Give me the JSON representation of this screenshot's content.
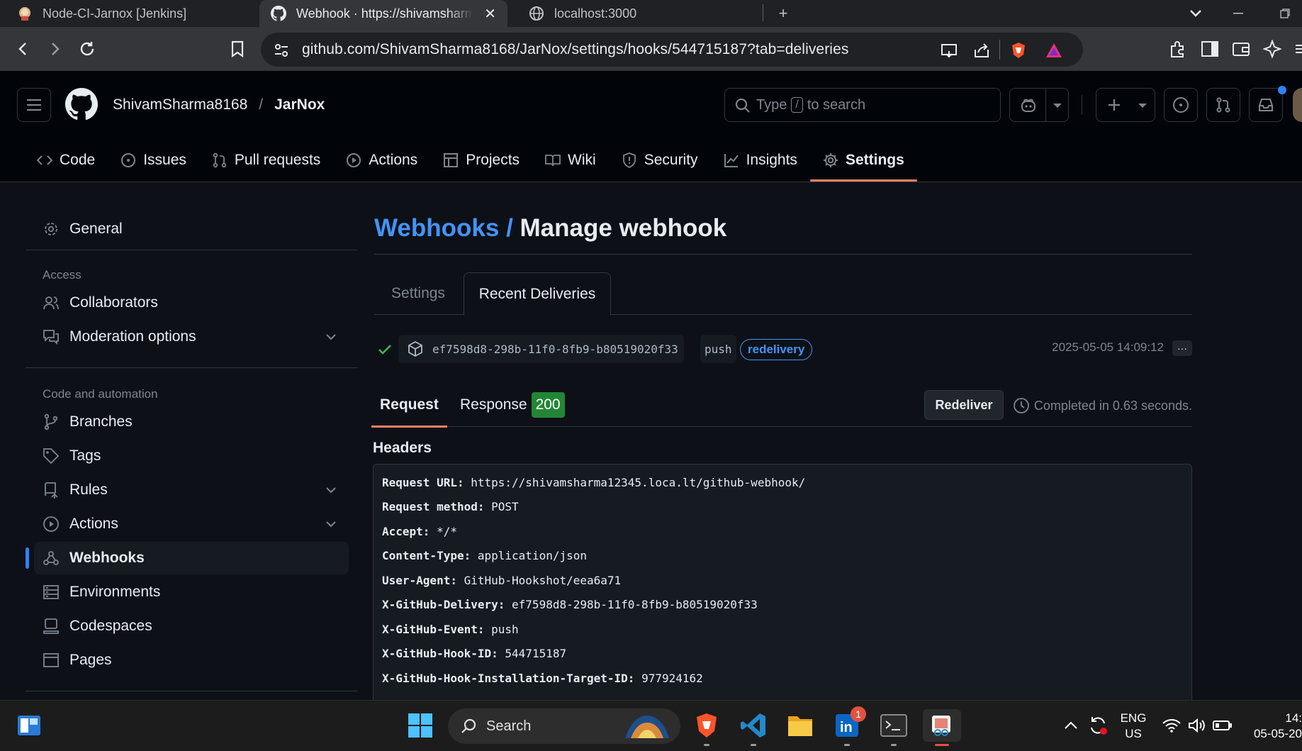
{
  "browser": {
    "tabs": [
      {
        "title": "Node-CI-Jarnox [Jenkins]"
      },
      {
        "title": "Webhook · https://shivamsharm",
        "active": true
      },
      {
        "title": "localhost:3000"
      }
    ],
    "url": "github.com/ShivamSharma8168/JarNox/settings/hooks/544715187?tab=deliveries"
  },
  "header": {
    "owner": "ShivamSharma8168",
    "separator": "/",
    "repo": "JarNox",
    "search_prefix": "Type",
    "search_key": "/",
    "search_suffix": "to search"
  },
  "repo_nav": [
    {
      "label": "Code",
      "icon": "code-icon"
    },
    {
      "label": "Issues",
      "icon": "issue-icon"
    },
    {
      "label": "Pull requests",
      "icon": "pull-request-icon"
    },
    {
      "label": "Actions",
      "icon": "play-icon"
    },
    {
      "label": "Projects",
      "icon": "table-icon"
    },
    {
      "label": "Wiki",
      "icon": "book-icon"
    },
    {
      "label": "Security",
      "icon": "shield-icon"
    },
    {
      "label": "Insights",
      "icon": "graph-icon"
    },
    {
      "label": "Settings",
      "icon": "gear-icon",
      "selected": true
    }
  ],
  "sidebar": {
    "general": "General",
    "access_heading": "Access",
    "access_items": [
      "Collaborators",
      "Moderation options"
    ],
    "code_heading": "Code and automation",
    "code_items": [
      "Branches",
      "Tags",
      "Rules",
      "Actions",
      "Webhooks",
      "Environments",
      "Codespaces",
      "Pages"
    ],
    "active": "Webhooks"
  },
  "main": {
    "breadcrumb": "Webhooks",
    "breadcrumb_sep": "/",
    "title": "Manage webhook",
    "tabs": [
      "Settings",
      "Recent Deliveries"
    ],
    "active_tab": "Recent Deliveries",
    "delivery": {
      "guid": "ef7598d8-298b-11f0-8fb9-b80519020f33",
      "event": "push",
      "badge": "redelivery",
      "timestamp": "2025-05-05 14:09:12",
      "more": "···"
    },
    "request_tabs": {
      "request": "Request",
      "response": "Response",
      "response_code": "200"
    },
    "redeliver_label": "Redeliver",
    "completed": "Completed in 0.63 seconds.",
    "headers_title": "Headers",
    "headers": [
      {
        "k": "Request URL:",
        "v": "https://shivamsharma12345.loca.lt/github-webhook/"
      },
      {
        "k": "Request method:",
        "v": "POST"
      },
      {
        "k": "Accept:",
        "v": "*/*"
      },
      {
        "k": "Content-Type:",
        "v": "application/json"
      },
      {
        "k": "User-Agent:",
        "v": "GitHub-Hookshot/eea6a71"
      },
      {
        "k": "X-GitHub-Delivery:",
        "v": "ef7598d8-298b-11f0-8fb9-b80519020f33"
      },
      {
        "k": "X-GitHub-Event:",
        "v": "push"
      },
      {
        "k": "X-GitHub-Hook-ID:",
        "v": "544715187"
      },
      {
        "k": "X-GitHub-Hook-Installation-Target-ID:",
        "v": "977924162"
      }
    ]
  },
  "taskbar": {
    "search": "Search",
    "lang_top": "ENG",
    "lang_bottom": "US",
    "clock_time": "14:",
    "clock_date": "05-05-20",
    "linkedin_badge": "1"
  },
  "colors": {
    "accent_blue": "#4493f8",
    "nav_underline": "#f78166",
    "success_green": "#238636"
  }
}
